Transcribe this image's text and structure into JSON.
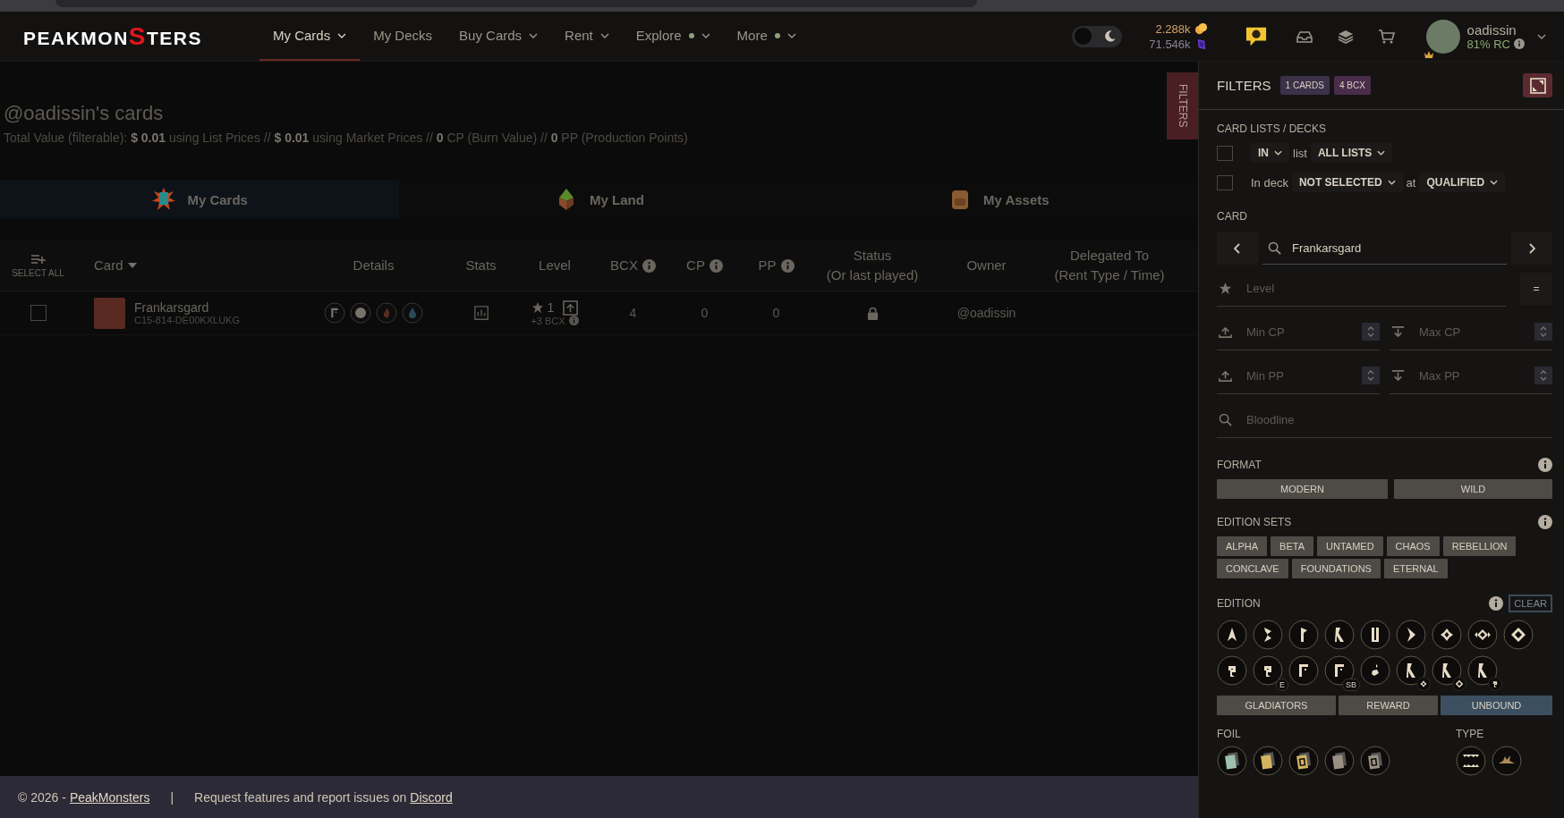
{
  "nav": {
    "logo": {
      "before": "PEAKMON",
      "accent": "S",
      "after": "TERS"
    },
    "items": [
      {
        "label": "My Cards",
        "selected": true,
        "dropdown": true,
        "dot": false
      },
      {
        "label": "My Decks",
        "selected": false,
        "dropdown": false,
        "dot": false
      },
      {
        "label": "Buy Cards",
        "selected": false,
        "dropdown": true,
        "dot": false
      },
      {
        "label": "Rent",
        "selected": false,
        "dropdown": true,
        "dot": false
      },
      {
        "label": "Explore",
        "selected": false,
        "dropdown": true,
        "dot": true
      },
      {
        "label": "More",
        "selected": false,
        "dropdown": true,
        "dot": true
      }
    ],
    "theme_toggle": {
      "on": false
    },
    "balances": [
      {
        "kind": "coin",
        "amount": "2.288k"
      },
      {
        "kind": "gem",
        "amount": "71.546k"
      }
    ],
    "user": {
      "name": "oadissin",
      "rc": "81% RC"
    }
  },
  "page": {
    "title": "@oadissin's cards",
    "summary": "Total Value (filterable): **$ 0.01** using List Prices //  **$ 0.01** using Market Prices //  **0** CP (Burn Value) //  **0** PP (Production Points)"
  },
  "tabs": [
    {
      "kind": "cards",
      "label": "My Cards",
      "selected": true
    },
    {
      "kind": "land",
      "label": "My Land",
      "selected": false
    },
    {
      "kind": "assets",
      "label": "My Assets",
      "selected": false
    }
  ],
  "table": {
    "select_all": "SELECT ALL",
    "columns": [
      {
        "label": "Card",
        "sortable": true,
        "info": false
      },
      {
        "label": "Details",
        "sortable": false,
        "info": false
      },
      {
        "label": "Stats",
        "sortable": false,
        "info": false
      },
      {
        "label": "Level",
        "sortable": false,
        "info": false
      },
      {
        "label": "BCX",
        "sortable": false,
        "info": true
      },
      {
        "label": "CP",
        "sortable": false,
        "info": true
      },
      {
        "label": "PP",
        "sortable": false,
        "info": true
      },
      {
        "label": "Status",
        "sub": "(Or last played)",
        "sortable": false,
        "info": false
      },
      {
        "label": "Owner",
        "sortable": false,
        "info": false
      },
      {
        "label": "Delegated To",
        "sub": "(Rent Type / Time)",
        "sortable": false,
        "info": false
      }
    ],
    "rows": [
      {
        "checked": false,
        "name": "Frankarsgard",
        "id": "C15-814-DE00KXLUKG",
        "level": "1",
        "bcx_extra": "+3 BCX",
        "bcx": "4",
        "cp": "0",
        "pp": "0",
        "locked": true,
        "owner": "@oadissin"
      }
    ]
  },
  "filters_tab": "FILTERS",
  "filters": {
    "title": "FILTERS",
    "badges": [
      "1 CARDS",
      "4 BCX"
    ],
    "lists_heading": "CARD LISTS / DECKS",
    "list_row": {
      "checked": false,
      "mode": "IN",
      "word": "list",
      "value": "ALL LISTS"
    },
    "deck_row": {
      "checked": false,
      "label": "In deck",
      "value": "NOT SELECTED",
      "at": "at",
      "qualified": "QUALIFIED"
    },
    "card_heading": "CARD",
    "search": {
      "value": "Frankarsgard"
    },
    "level": {
      "placeholder": "Level",
      "operator": "="
    },
    "ranges": [
      {
        "kind": "min",
        "placeholder": "Min CP"
      },
      {
        "kind": "max",
        "placeholder": "Max CP"
      },
      {
        "kind": "min",
        "placeholder": "Min PP"
      },
      {
        "kind": "max",
        "placeholder": "Max PP"
      }
    ],
    "bloodline": {
      "placeholder": "Bloodline"
    },
    "format": {
      "heading": "FORMAT",
      "options": [
        {
          "label": "MODERN",
          "selected": false
        },
        {
          "label": "WILD",
          "selected": false
        }
      ]
    },
    "edition_sets": {
      "heading": "EDITION SETS",
      "options": [
        {
          "label": "ALPHA",
          "selected": false
        },
        {
          "label": "BETA",
          "selected": false
        },
        {
          "label": "UNTAMED",
          "selected": false
        },
        {
          "label": "CHAOS",
          "selected": false
        },
        {
          "label": "REBELLION",
          "selected": false
        },
        {
          "label": "CONCLAVE",
          "selected": false
        },
        {
          "label": "FOUNDATIONS",
          "selected": false
        },
        {
          "label": "ETERNAL",
          "selected": false
        }
      ]
    },
    "edition": {
      "heading": "EDITION",
      "clear": "CLEAR",
      "icons": [
        {
          "kind": "spike"
        },
        {
          "kind": "zigzag"
        },
        {
          "kind": "flag"
        },
        {
          "kind": "runner"
        },
        {
          "kind": "bar"
        },
        {
          "kind": "chevron"
        },
        {
          "kind": "knot"
        },
        {
          "kind": "rift"
        },
        {
          "kind": "diamond"
        },
        {
          "kind": "hook"
        },
        {
          "kind": "hook",
          "badge": "E"
        },
        {
          "kind": "gate"
        },
        {
          "kind": "gate",
          "badge": "SB"
        },
        {
          "kind": "drop"
        },
        {
          "kind": "runner-knot"
        },
        {
          "kind": "runner-diamond"
        },
        {
          "kind": "runner-hook"
        }
      ],
      "groups": [
        {
          "label": "GLADIATORS",
          "selected": false
        },
        {
          "label": "REWARD",
          "selected": false
        },
        {
          "label": "UNBOUND",
          "selected": true
        }
      ]
    },
    "foil": {
      "heading": "FOIL"
    },
    "type": {
      "heading": "TYPE"
    }
  },
  "footer": {
    "copyright": "© 2026 -",
    "brand": "PeakMonsters",
    "separator": "|",
    "text": "Request features and report issues on",
    "link": "Discord"
  }
}
